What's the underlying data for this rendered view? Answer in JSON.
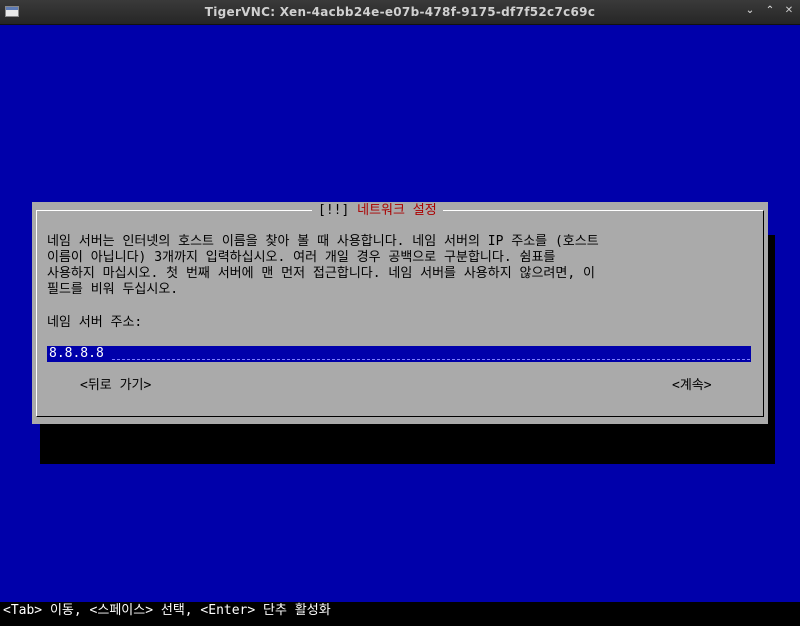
{
  "window": {
    "title": "TigerVNC: Xen-4acbb24e-e07b-478f-9175-df7f52c7c69c",
    "controls": {
      "minimize": "⌄",
      "maximize": "⌃",
      "close": "✕"
    }
  },
  "dialog": {
    "title_left": "[!!]",
    "title_text": "네트워크 설정",
    "description": [
      "네임 서버는 인터넷의 호스트 이름을 찾아 볼 때 사용합니다. 네임 서버의 IP 주소를 (호스트",
      "이름이 아닙니다) 3개까지 입력하십시오. 여러 개일 경우 공백으로 구분합니다. 쉼표를",
      "사용하지 마십시오. 첫 번째 서버에 맨 먼저 접근합니다. 네임 서버를 사용하지 않으려면, 이",
      "필드를 비워 두십시오."
    ],
    "field_label": "네임 서버 주소:",
    "field_value": "8.8.8.8",
    "back_label": "<뒤로 가기>",
    "continue_label": "<계속>"
  },
  "status": {
    "help_text": "<Tab> 이동, <스페이스> 선택, <Enter> 단추 활성화"
  },
  "colors": {
    "screen_bg": "#0000aa",
    "dialog_bg": "#aaaaaa",
    "title_fg": "#aa0000"
  }
}
